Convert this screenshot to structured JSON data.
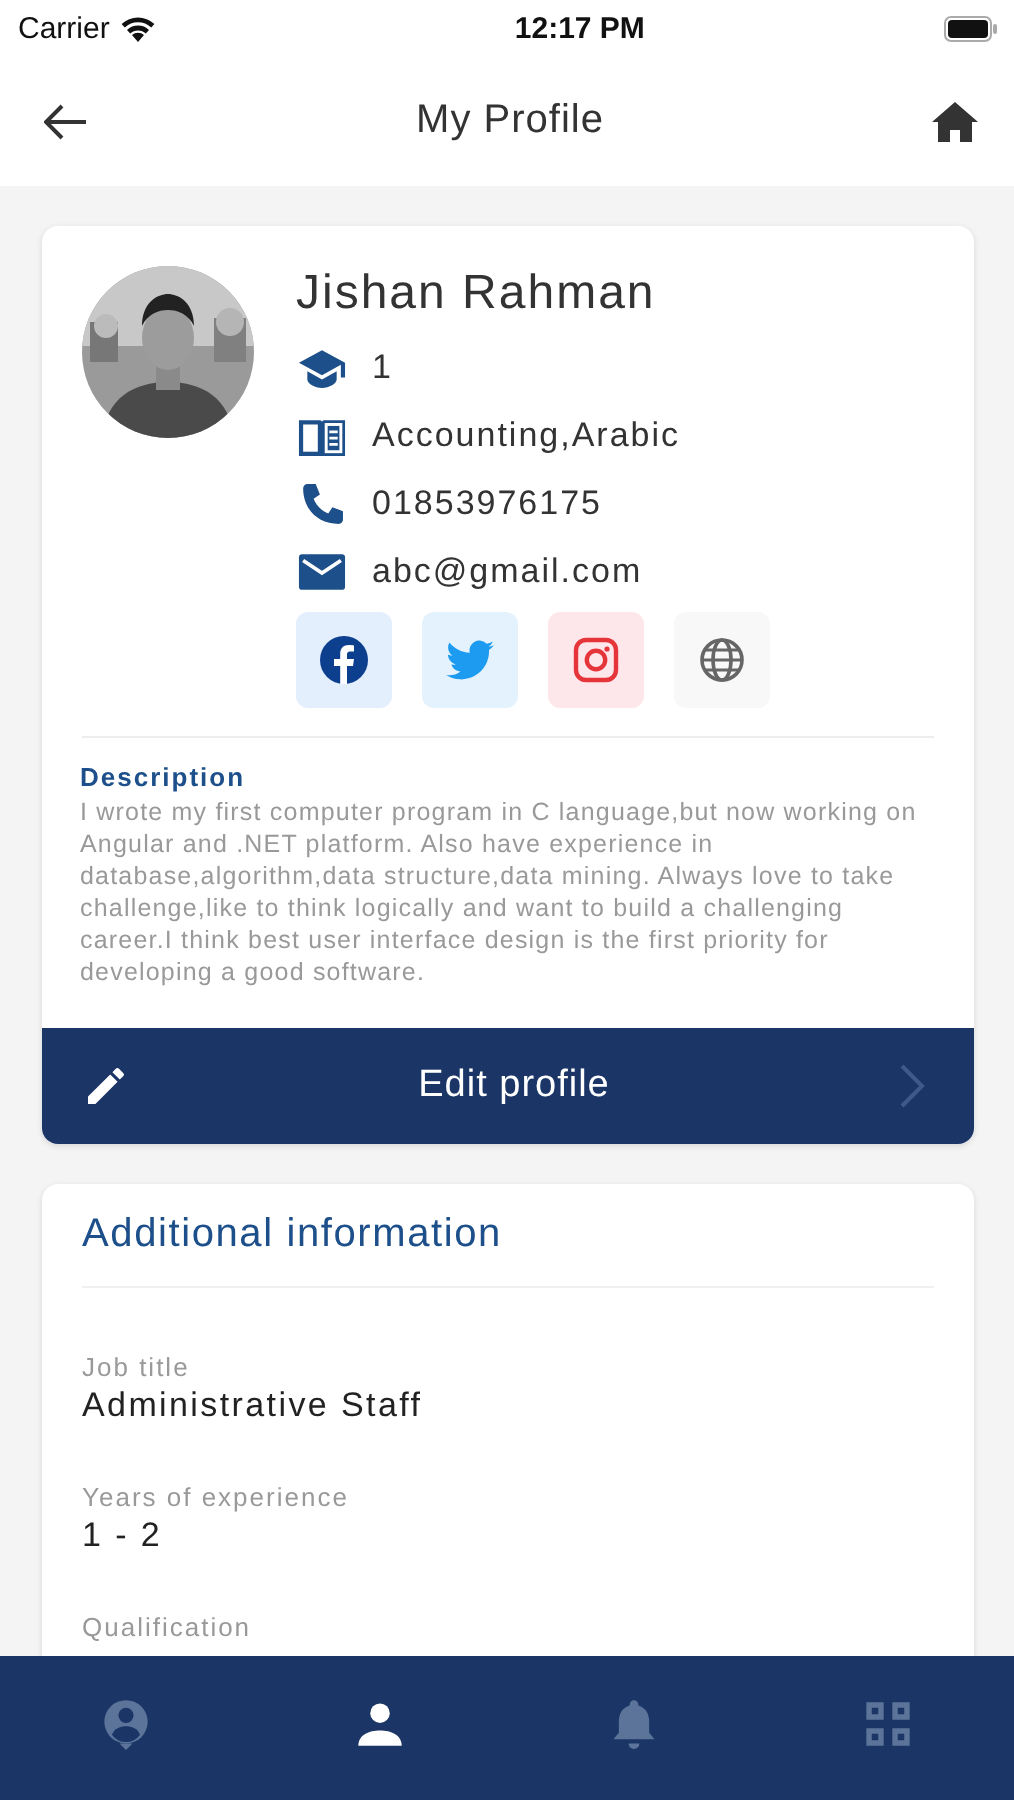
{
  "status_bar": {
    "carrier": "Carrier",
    "time": "12:17 PM"
  },
  "header": {
    "title": "My Profile"
  },
  "profile": {
    "name": "Jishan Rahman",
    "details": [
      {
        "kind": "degree",
        "text": "1"
      },
      {
        "kind": "subjects",
        "text": "Accounting,Arabic"
      },
      {
        "kind": "phone",
        "text": "01853976175"
      },
      {
        "kind": "email",
        "text": "abc@gmail.com"
      }
    ],
    "social": [
      {
        "kind": "facebook"
      },
      {
        "kind": "twitter"
      },
      {
        "kind": "instagram"
      },
      {
        "kind": "web"
      }
    ],
    "description_label": "Description",
    "description": "I wrote my first computer program in C language,but now working on Angular and .NET platform. Also have experience in database,algorithm,data structure,data mining. Always love to take challenge,like to think logically and want to build a challenging career.I think best user interface design is the first priority for developing a good software.",
    "edit_button": "Edit profile"
  },
  "additional": {
    "title": "Additional information",
    "fields": [
      {
        "label": "Job title",
        "value": "Administrative Staff"
      },
      {
        "label": "Years of experience",
        "value": "1 - 2"
      },
      {
        "label": "Qualification"
      }
    ]
  },
  "bottom_nav": [
    {
      "kind": "account",
      "selected": false
    },
    {
      "kind": "person",
      "selected": true
    },
    {
      "kind": "bell",
      "selected": false
    },
    {
      "kind": "grid",
      "selected": false
    }
  ]
}
